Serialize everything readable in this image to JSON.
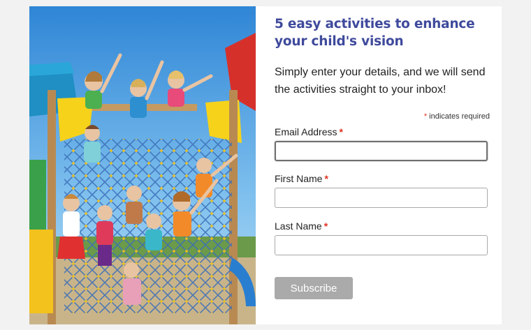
{
  "signup": {
    "headline": "5 easy activities to enhance your child's vision",
    "subtitle": "Simply enter your details, and we will send the activities straight to your inbox!",
    "required_marker": "*",
    "required_note": "indicates required",
    "fields": [
      {
        "label": "Email Address",
        "value": "",
        "placeholder": ""
      },
      {
        "label": "First Name",
        "value": "",
        "placeholder": ""
      },
      {
        "label": "Last Name",
        "value": "",
        "placeholder": ""
      }
    ],
    "submit_label": "Subscribe"
  },
  "photo": {
    "subject": "children waving on a playground climbing net"
  },
  "colors": {
    "headline": "#3f4a9c",
    "required": "#e0311f",
    "button_bg": "#aaaaaa",
    "page_bg": "#f2f2f2"
  }
}
